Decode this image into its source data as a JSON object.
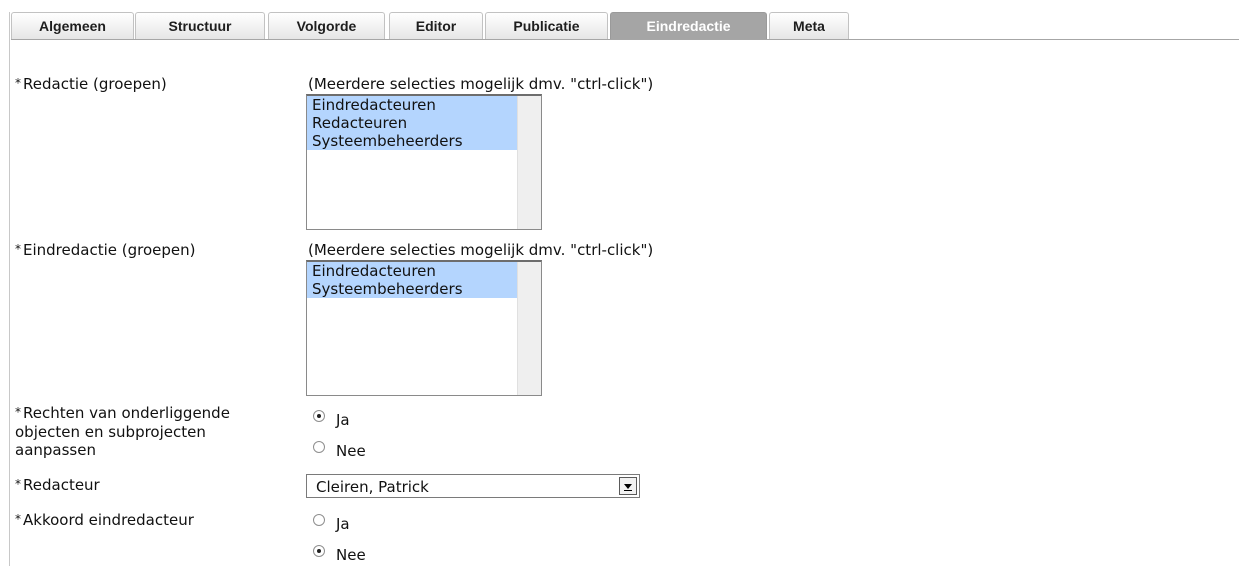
{
  "tabs": [
    {
      "label": "Algemeen",
      "active": false
    },
    {
      "label": "Structuur",
      "active": false
    },
    {
      "label": "Volgorde",
      "active": false
    },
    {
      "label": "Editor",
      "active": false
    },
    {
      "label": "Publicatie",
      "active": false
    },
    {
      "label": "Eindredactie",
      "active": true
    },
    {
      "label": "Meta",
      "active": false
    }
  ],
  "required_marker": "*",
  "form": {
    "redactie": {
      "label": "Redactie (groepen)",
      "hint": "(Meerdere selecties mogelijk dmv. \"ctrl-click\")",
      "options": [
        "Eindredacteuren",
        "Redacteuren",
        "Systeembeheerders"
      ]
    },
    "eindredactie": {
      "label": "Eindredactie (groepen)",
      "hint": "(Meerdere selecties mogelijk dmv. \"ctrl-click\")",
      "options": [
        "Eindredacteuren",
        "Systeembeheerders"
      ]
    },
    "rechten": {
      "label_lines": [
        "Rechten van onderliggende",
        "objecten en subprojecten",
        "aanpassen"
      ],
      "options": [
        {
          "label": "Ja",
          "checked": true
        },
        {
          "label": "Nee",
          "checked": false
        }
      ]
    },
    "redacteur": {
      "label": "Redacteur",
      "selected": "Cleiren, Patrick"
    },
    "akkoord": {
      "label": "Akkoord eindredacteur",
      "options": [
        {
          "label": "Ja",
          "checked": false
        },
        {
          "label": "Nee",
          "checked": true
        }
      ]
    }
  },
  "colors": {
    "selection": "#b4d5fe",
    "active_tab": "#a5a5a5"
  }
}
